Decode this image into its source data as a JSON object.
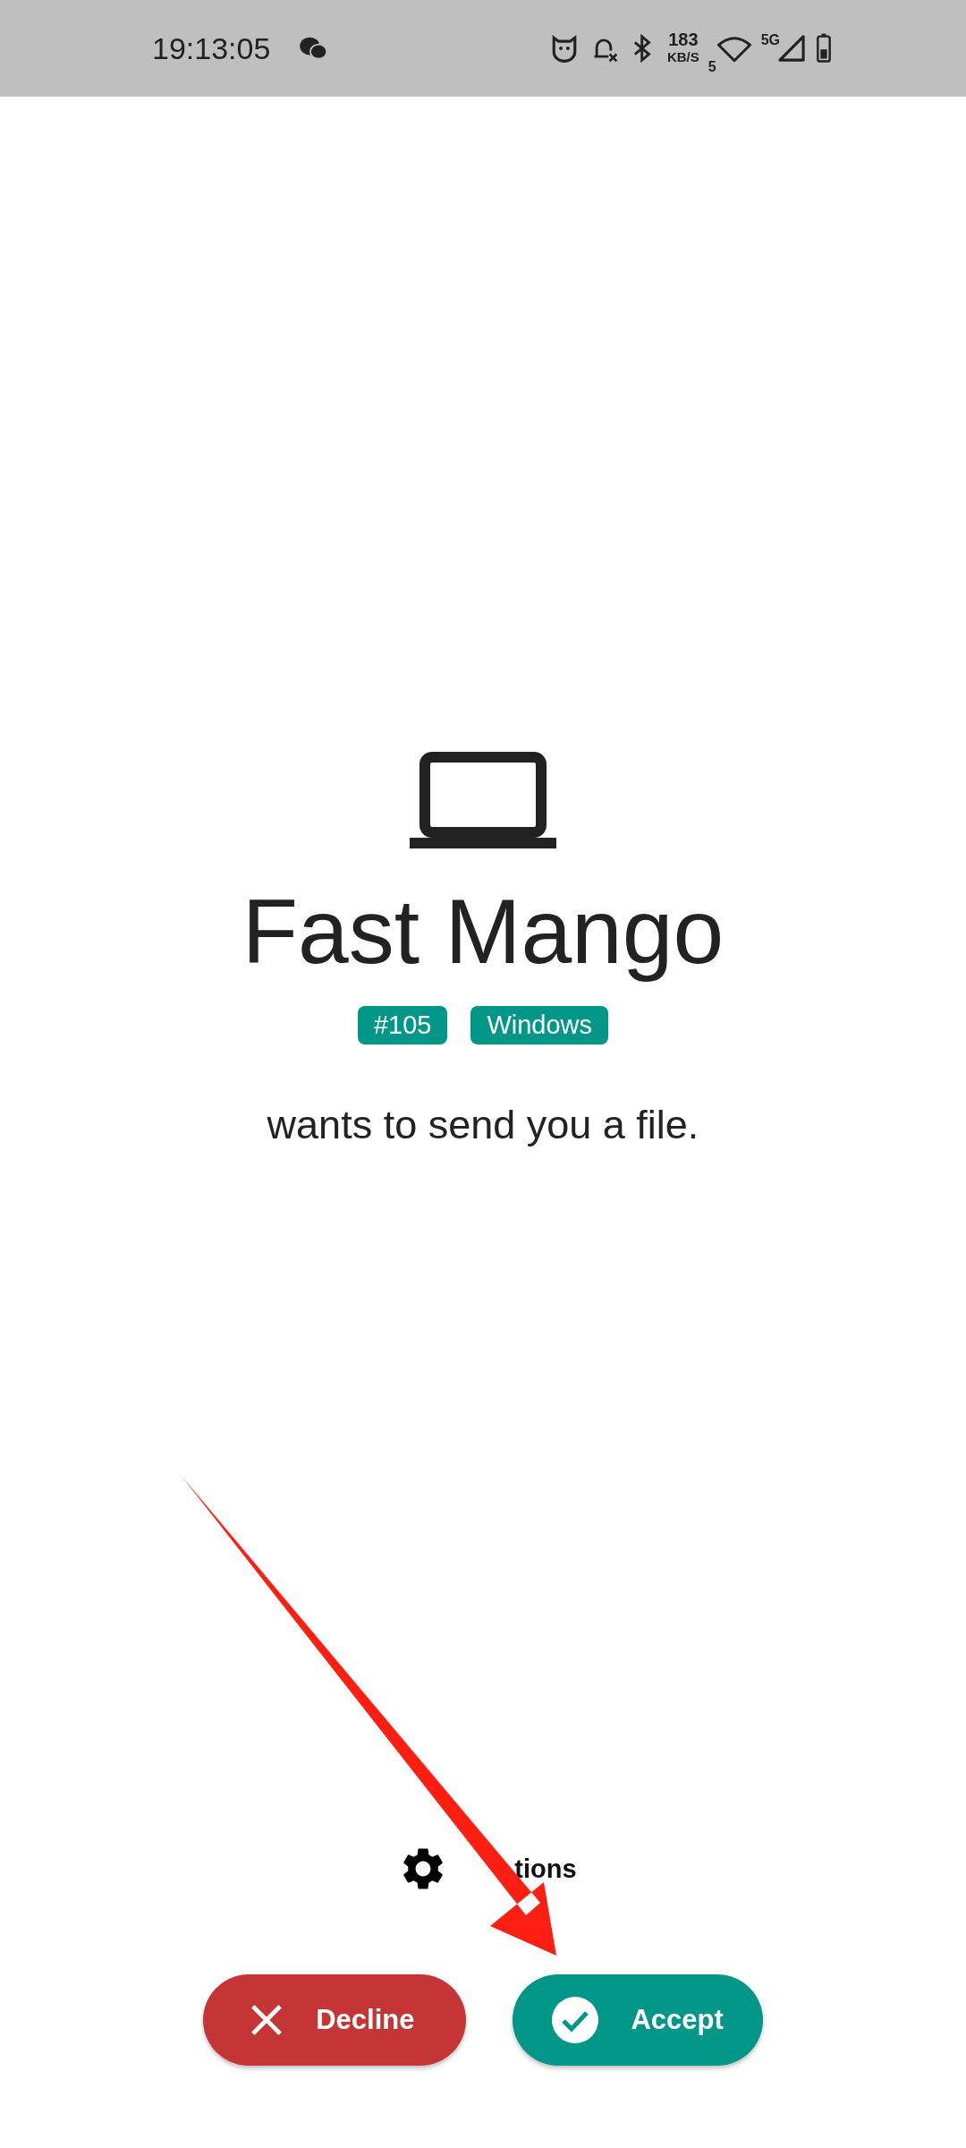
{
  "status_bar": {
    "time": "19:13:05",
    "speed_value": "183",
    "speed_unit": "KB/S",
    "wifi_label": "5",
    "network_label": "5G"
  },
  "device": {
    "name": "Fast Mango",
    "tags": [
      "#105",
      "Windows"
    ]
  },
  "message": "wants to send you a file.",
  "options": {
    "label": "tions"
  },
  "buttons": [
    {
      "kind": "decline",
      "label": "Decline"
    },
    {
      "kind": "accept",
      "label": "Accept"
    }
  ]
}
